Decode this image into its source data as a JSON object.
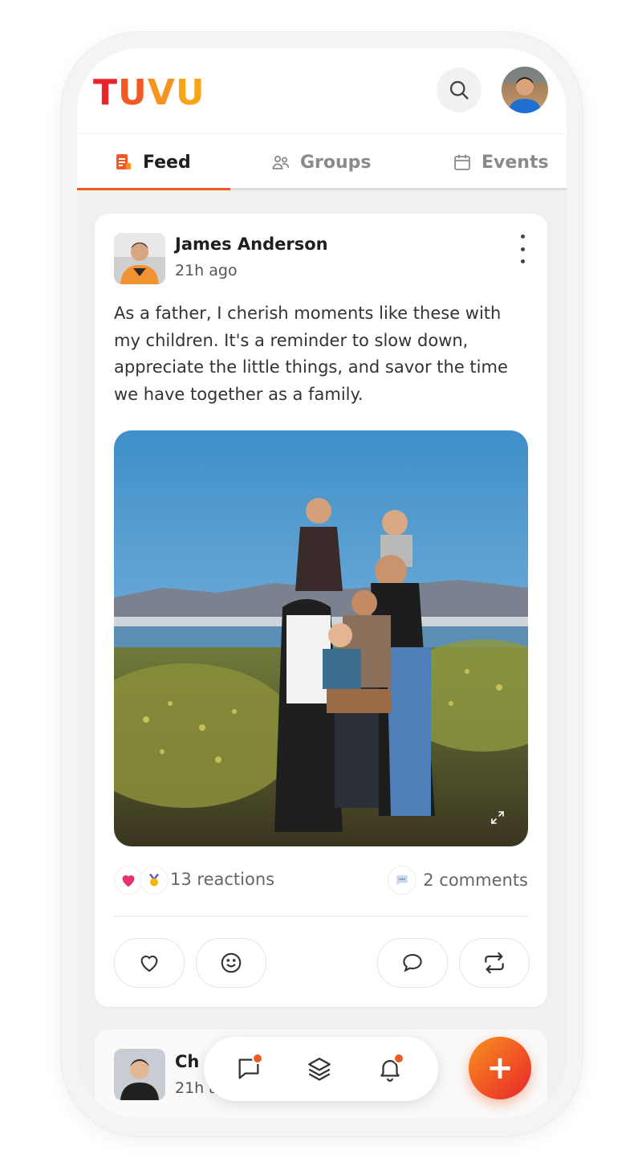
{
  "app": {
    "logo_text": "TUVU"
  },
  "colors": {
    "accent": "#f15a24",
    "accent_dark": "#e8252a",
    "accent_light": "#f7931e"
  },
  "header": {
    "search_icon": "search-icon",
    "avatar_icon": "avatar"
  },
  "tabs": [
    {
      "label": "Feed",
      "icon": "document-icon",
      "active": true
    },
    {
      "label": "Groups",
      "icon": "people-icon",
      "active": false
    },
    {
      "label": "Events",
      "icon": "calendar-icon",
      "active": false
    }
  ],
  "post": {
    "author": "James Anderson",
    "time": "21h ago",
    "text": "As a father, I cherish moments like these with my children. It's a reminder to slow down, appreciate the little things, and savor the time we have together as a family.",
    "reactions_label": "13 reactions",
    "comments_label": "2 comments",
    "reaction_icons": [
      "heart-icon",
      "celebrate-icon"
    ],
    "actions": [
      "heart-icon",
      "smile-icon",
      "comment-icon",
      "repost-icon"
    ]
  },
  "next_post": {
    "author": "Ch",
    "time": "21h ag"
  },
  "bottom_nav": {
    "items": [
      {
        "icon": "chat-icon",
        "badge": true
      },
      {
        "icon": "layers-icon",
        "badge": false
      },
      {
        "icon": "bell-icon",
        "badge": true
      }
    ],
    "fab_label": "+"
  }
}
